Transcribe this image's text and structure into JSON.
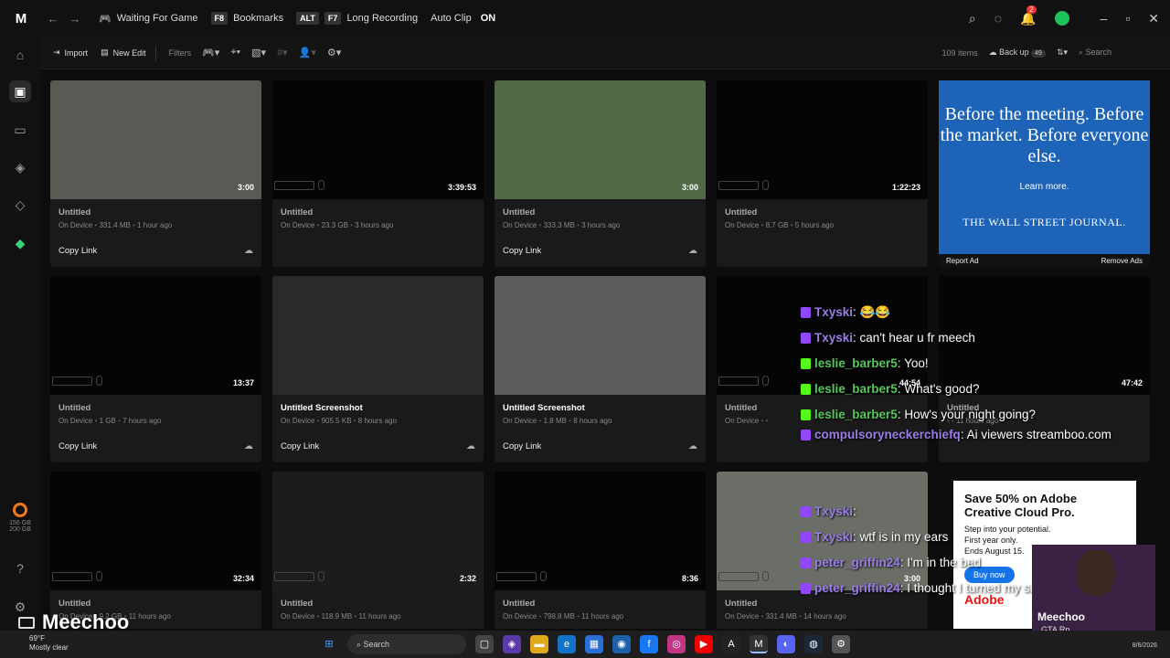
{
  "titlebar": {
    "logo": "M",
    "status": "Waiting For Game",
    "bookmarks_key": "F8",
    "bookmarks": "Bookmarks",
    "alt_key": "ALT",
    "recording_key": "F7",
    "long_recording": "Long Recording",
    "autoclip": "Auto Clip",
    "autoclip_state": "ON",
    "notifications": "2"
  },
  "toolbar": {
    "import": "Import",
    "new_edit": "New Edit",
    "filters": "Filters",
    "items_count": "109 items",
    "backup": "Back up",
    "backup_count": "49",
    "search_placeholder": "Search"
  },
  "sidebar": {
    "storage_used": "156 GB",
    "storage_total": "200 GB"
  },
  "cards": [
    {
      "title": "Untitled",
      "duration": "3:00",
      "location": "On Device",
      "size": "331.4 MB",
      "time": "1 hour ago",
      "action": "Copy Link",
      "thumb": "#5a5a55",
      "kb": false
    },
    {
      "title": "Untitled",
      "duration": "3:39:53",
      "location": "On Device",
      "size": "23.3 GB",
      "time": "3 hours ago",
      "action": "",
      "thumb": "#050505",
      "kb": true
    },
    {
      "title": "Untitled",
      "duration": "3:00",
      "location": "On Device",
      "size": "333.3 MB",
      "time": "3 hours ago",
      "action": "Copy Link",
      "thumb": "#4f6a45",
      "kb": false
    },
    {
      "title": "Untitled",
      "duration": "1:22:23",
      "location": "On Device",
      "size": "8.7 GB",
      "time": "5 hours ago",
      "action": "",
      "thumb": "#050505",
      "kb": true
    },
    {
      "title": "Untitled",
      "duration": "13:37",
      "location": "On Device",
      "size": "1 GB",
      "time": "7 hours ago",
      "action": "Copy Link",
      "thumb": "#050505",
      "kb": true
    },
    {
      "title": "Untitled Screenshot",
      "duration": "",
      "location": "On Device",
      "size": "905.5 KB",
      "time": "8 hours ago",
      "action": "Copy Link",
      "thumb": "#2a2a2a",
      "kb": false
    },
    {
      "title": "Untitled Screenshot",
      "duration": "",
      "location": "On Device",
      "size": "1.8 MB",
      "time": "8 hours ago",
      "action": "Copy Link",
      "thumb": "#5c5c5c",
      "kb": false
    },
    {
      "title": "Untitled",
      "duration": "44:54",
      "location": "On Device",
      "size": "",
      "time": "",
      "action": "",
      "thumb": "#050505",
      "kb": true
    },
    {
      "title": "Untitled",
      "duration": "47:42",
      "location": "",
      "size": "",
      "time": "11 hours ago",
      "action": "",
      "thumb": "#050505",
      "kb": false
    },
    {
      "title": "Untitled",
      "duration": "32:34",
      "location": "On Device",
      "size": "9.2 GB",
      "time": "11 hours ago",
      "action": "",
      "thumb": "#050505",
      "kb": true
    },
    {
      "title": "Untitled",
      "duration": "2:32",
      "location": "On Device",
      "size": "118.9 MB",
      "time": "11 hours ago",
      "action": "",
      "thumb": "#1a1c1e",
      "kb": true
    },
    {
      "title": "Untitled",
      "duration": "8:36",
      "location": "On Device",
      "size": "798.8 MB",
      "time": "11 hours ago",
      "action": "",
      "thumb": "#050505",
      "kb": true
    },
    {
      "title": "Untitled",
      "duration": "3:00",
      "location": "On Device",
      "size": "331.4 MB",
      "time": "14 hours ago",
      "action": "",
      "thumb": "#6a6e66",
      "kb": true
    }
  ],
  "ad": {
    "headline": "Before the meeting. Before the market. Before everyone else.",
    "cta": "Learn more.",
    "brand": "THE WALL STREET JOURNAL.",
    "report": "Report Ad",
    "remove": "Remove Ads"
  },
  "ad2": {
    "title": "Save 50% on Adobe Creative Cloud Pro.",
    "sub1": "Step into your potential.",
    "sub2": "First year only.",
    "sub3": "Ends August 15.",
    "button": "Buy now",
    "brand": "Adobe"
  },
  "chat": [
    {
      "user": "Txyski",
      "text": "😂😂",
      "platform": "twitch"
    },
    {
      "user": "Txyski",
      "text": "can't hear u fr meech",
      "platform": "twitch"
    },
    {
      "user": "leslie_barber5",
      "text": "Yoo!",
      "platform": "kick"
    },
    {
      "user": "leslie_barber5",
      "text": "What's good?",
      "platform": "kick"
    },
    {
      "user": "leslie_barber5",
      "text": "How's your night going?",
      "platform": "kick"
    },
    {
      "user": "compulsoryneckerchiefq",
      "text": "Ai viewers streamboo.com",
      "platform": "twitch"
    }
  ],
  "chat2": [
    {
      "user": "Txyski",
      "text": "",
      "platform": "twitch"
    },
    {
      "user": "Txyski",
      "text": "wtf is in my ears",
      "platform": "twitch"
    },
    {
      "user": "peter_griffin24",
      "text": "I'm in the bed",
      "platform": "twitch"
    },
    {
      "user": "peter_griffin24",
      "text": "I thought I turned my shut off",
      "platform": "twitch"
    }
  ],
  "overlay": {
    "name": "Meechoo"
  },
  "streamer": {
    "name": "Meechoo",
    "sub": "GTA Rp"
  },
  "taskbar": {
    "temp": "69°F",
    "weather": "Mostly clear",
    "search": "Search",
    "date": "8/6/2026"
  }
}
